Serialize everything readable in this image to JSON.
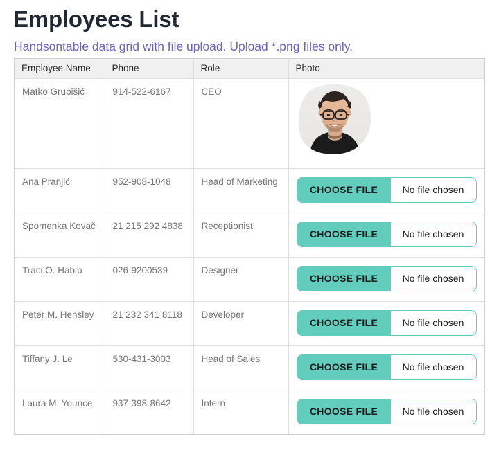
{
  "header": {
    "title": "Employees List",
    "subtitle": "Handsontable data grid with file upload. Upload *.png files only."
  },
  "colors": {
    "title": "#222833",
    "subtitle": "#6c63bb",
    "accent_teal": "#62ccbd",
    "header_bg": "#f0f0f0",
    "cell_text": "#767676",
    "grid_border": "#dfdfdf"
  },
  "table": {
    "columns": [
      {
        "key": "name",
        "label": "Employee Name"
      },
      {
        "key": "phone",
        "label": "Phone"
      },
      {
        "key": "role",
        "label": "Role"
      },
      {
        "key": "photo",
        "label": "Photo"
      }
    ],
    "file_input": {
      "button_label": "CHOOSE FILE",
      "status_text": "No file chosen"
    },
    "rows": [
      {
        "name": "Matko Grubišić",
        "phone": "914-522-6167",
        "role": "CEO",
        "photo_type": "image",
        "photo_alt": "employee-photo-matko-grubisic"
      },
      {
        "name": "Ana Pranjić",
        "phone": "952-908-1048",
        "role": "Head of Marketing",
        "photo_type": "file-input"
      },
      {
        "name": "Spomenka Kovač",
        "phone": "21 215 292 4838",
        "role": "Receptionist",
        "photo_type": "file-input"
      },
      {
        "name": "Traci O. Habib",
        "phone": "026-9200539",
        "role": "Designer",
        "photo_type": "file-input"
      },
      {
        "name": "Peter M. Hensley",
        "phone": "21 232 341 8118",
        "role": "Developer",
        "photo_type": "file-input"
      },
      {
        "name": "Tiffany J. Le",
        "phone": "530-431-3003",
        "role": "Head of Sales",
        "photo_type": "file-input"
      },
      {
        "name": "Laura M. Younce",
        "phone": "937-398-8642",
        "role": "Intern",
        "photo_type": "file-input"
      }
    ]
  }
}
